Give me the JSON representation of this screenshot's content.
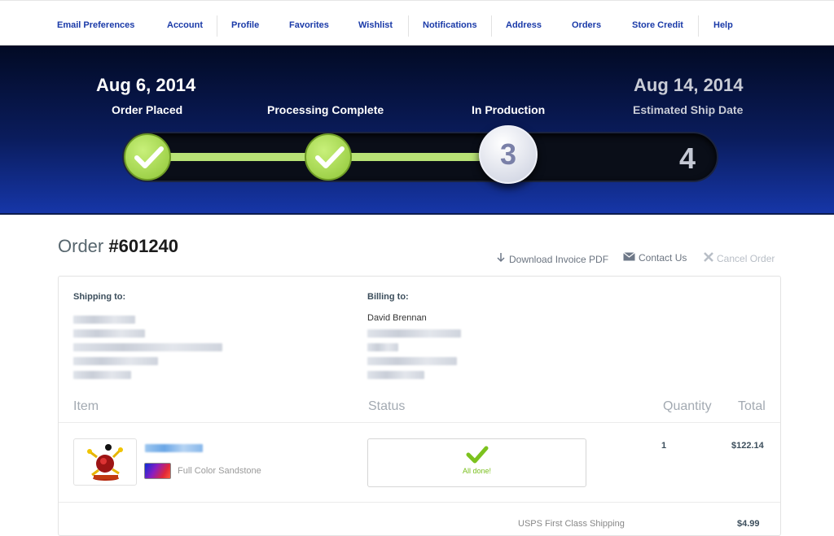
{
  "nav": {
    "items": [
      "Email Preferences",
      "Account",
      "Profile",
      "Favorites",
      "Wishlist",
      "Notifications",
      "Address",
      "Orders",
      "Store Credit",
      "Help"
    ]
  },
  "progress": {
    "start_date": "Aug 6, 2014",
    "end_date": "Aug 14, 2014",
    "steps": [
      {
        "label": "Order Placed",
        "state": "done"
      },
      {
        "label": "Processing Complete",
        "state": "done"
      },
      {
        "label": "In Production",
        "state": "current",
        "number": "3"
      },
      {
        "label": "Estimated Ship Date",
        "state": "future",
        "number": "4"
      }
    ]
  },
  "order": {
    "title_prefix": "Order",
    "number": "#601240",
    "actions": {
      "download": "Download Invoice PDF",
      "contact": "Contact Us",
      "cancel": "Cancel Order"
    },
    "shipping_heading": "Shipping to:",
    "billing_heading": "Billing to:",
    "billing_name": "David Brennan",
    "columns": {
      "item": "Item",
      "status": "Status",
      "quantity": "Quantity",
      "total": "Total"
    },
    "items": [
      {
        "material": "Full Color Sandstone",
        "status": "All done!",
        "quantity": "1",
        "total": "$122.14"
      }
    ],
    "shipping_method": "USPS First Class Shipping",
    "shipping_cost": "$4.99"
  },
  "colors": {
    "accent": "#1a3aa8",
    "done_green": "#8fc637",
    "banner_dark": "#020a24"
  }
}
